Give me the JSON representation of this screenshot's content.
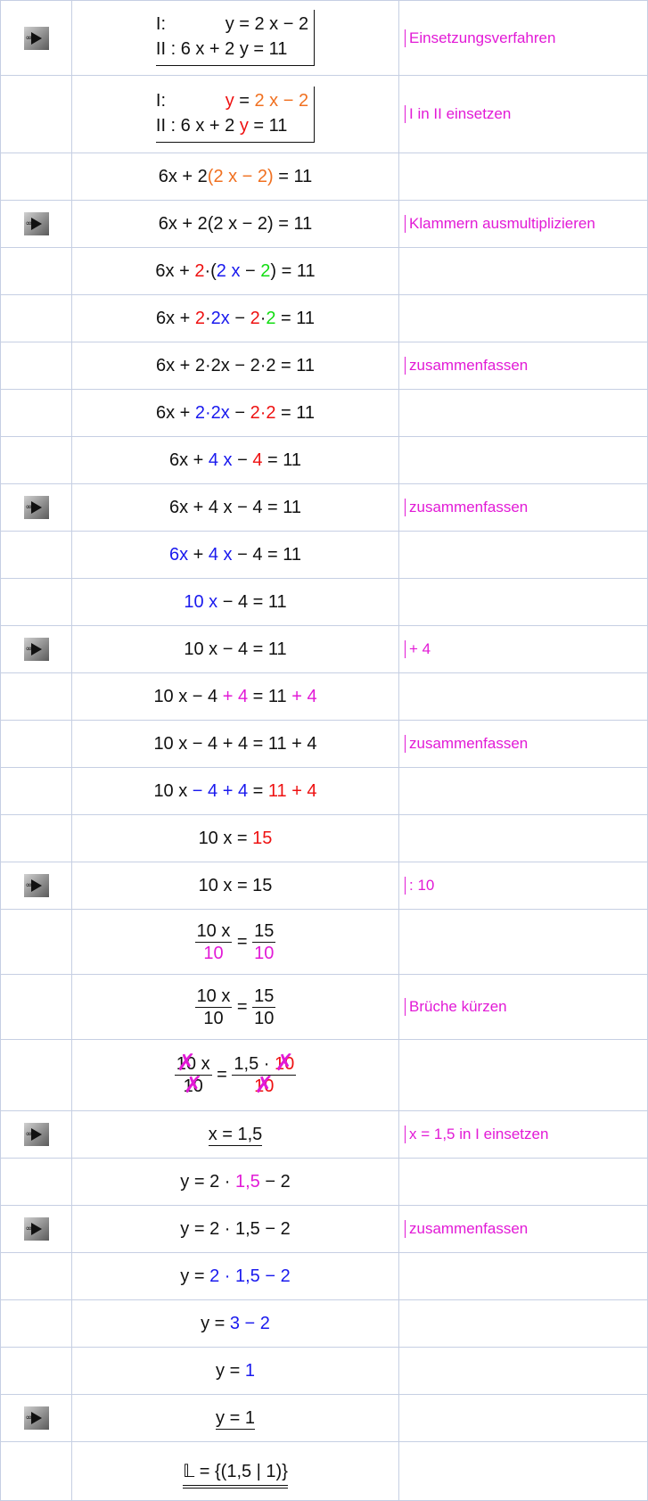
{
  "notes": {
    "einsetzungsverfahren": "Einsetzungsverfahren",
    "i_in_ii": "I in II einsetzen",
    "klammern": "Klammern ausmultiplizieren",
    "zusammenfassen": "zusammenfassen",
    "plus4": "+ 4",
    "div10": ": 10",
    "brueche": "Brüche kürzen",
    "x_einsetzen": "x = 1,5 in I einsetzen"
  },
  "math": {
    "r1a": "I:            y = 2 x − 2",
    "r1b": "II : 6 x + 2 y = 11",
    "r3": "6x + 2(2 x − 2) = 11",
    "r4": "6x + 2(2 x − 2) = 11",
    "r6": "6x + 2·2x − 2·2 = 11",
    "r7": "6x + 2·2x − 2·2 = 11",
    "r8": "6x + 2·2x − 2·2 = 11",
    "r9": "6x + 4 x − 4 = 11",
    "r10": "6x + 4 x − 4 = 11",
    "r11": "6x + 4 x − 4 = 11",
    "r12": "10 x − 4 = 11",
    "r13": "10 x − 4 = 11",
    "r14": "10 x − 4 + 4 = 11 + 4",
    "r15": "10 x − 4 + 4 = 11 + 4",
    "r16": "10 x − 4 + 4 = 11 + 4",
    "r17": "10 x = 15",
    "r18": "10 x = 15",
    "frac_10x": "10 x",
    "frac_10": "10",
    "frac_15": "15",
    "frac_15x": "1,5 ·",
    "x_result": "x = 1,5",
    "y_sub": "y = 2 · 1,5 − 2",
    "y_32": "y = 3 − 2",
    "y_res": "y = 1",
    "solution": "𝕃 = {(1,5 | 1)}"
  },
  "icon": "play-arrow-icon"
}
